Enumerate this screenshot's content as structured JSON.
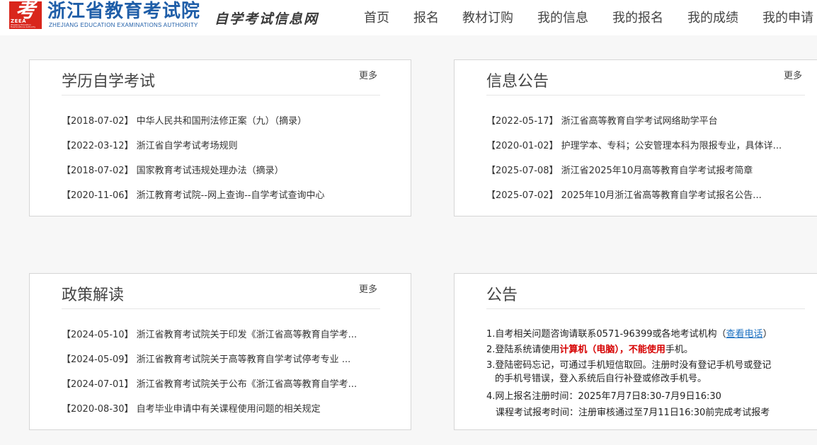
{
  "header": {
    "logo_glyph": "考",
    "logo_abbr": "ZEEA",
    "logo_tiny": "Zhejiang Education Examinations Authority",
    "org_name": "浙江省教育考试院",
    "org_name_en": "ZHEJIANG EDUCATION EXAMINATIONS AUTHORITY",
    "site_name": "自学考试信息网",
    "brand_color": "#1f5ea8",
    "logo_color": "#d9261c"
  },
  "nav": {
    "items": [
      "首页",
      "报名",
      "教材订购",
      "我的信息",
      "我的报名",
      "我的成绩",
      "我的申请"
    ]
  },
  "panels": {
    "academic": {
      "title": "学历自学考试",
      "more": "更多",
      "items": [
        "【2018-07-02】 中华人民共和国刑法修正案（九）（摘录）",
        "【2022-03-12】 浙江省自学考试考场规则",
        "【2018-07-02】 国家教育考试违规处理办法（摘录）",
        "【2020-11-06】 浙江教育考试院--网上查询--自学考试查询中心"
      ]
    },
    "info": {
      "title": "信息公告",
      "more": "更多",
      "items": [
        "【2022-05-17】 浙江省高等教育自学考试网络助学平台",
        "【2020-01-02】 护理学本、专科；公安管理本科为限报专业，具体详...",
        "【2025-07-08】 浙江省2025年10月高等教育自学考试报考简章",
        "【2025-07-02】 2025年10月浙江省高等教育自学考试报名公告..."
      ]
    },
    "policy": {
      "title": "政策解读",
      "more": "更多",
      "items": [
        "【2024-05-10】 浙江省教育考试院关于印发《浙江省高等教育自学考...",
        "【2024-05-09】 浙江省教育考试院关于高等教育自学考试停考专业 ...",
        "【2024-07-01】 浙江省教育考试院关于公布《浙江省高等教育自学考...",
        "【2020-08-30】 自考毕业申请中有关课程使用问题的相关规定"
      ]
    },
    "notice": {
      "title": "公告",
      "line1_pre": "1.自考相关问题咨询请联系0571-96399或各地考试机构（",
      "line1_link": "查看电话",
      "line1_post": "）",
      "line2_pre": "2.登陆系统请使用",
      "line2_red1": "计算机（电脑），不能使用",
      "line2_post": "手机。",
      "line3a": "3.登陆密码忘记，可通过手机短信取回。注册时没有登记手机号或登记",
      "line3b": "的手机号错误，登入系统后自行补登或修改手机号。",
      "line4a": "4.网上报名注册时间：2025年7月7日8:30-7月9日16:30",
      "line4b": "课程考试报考时间：注册审核通过至7月11日16:30前完成考试报考"
    }
  }
}
